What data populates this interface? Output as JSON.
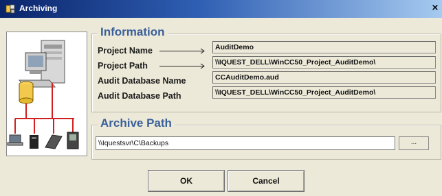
{
  "window": {
    "title": "Archiving",
    "close_glyph": "×"
  },
  "information": {
    "heading": "Information",
    "fields": [
      {
        "label": "Project Name",
        "value": "AuditDemo"
      },
      {
        "label": "Project Path",
        "value": "\\\\IQUEST_DELL\\WinCC50_Project_AuditDemo\\"
      },
      {
        "label": "Audit Database Name",
        "value": "CCAuditDemo.aud"
      },
      {
        "label": "Audit Database Path",
        "value": "\\\\IQUEST_DELL\\WinCC50_Project_AuditDemo\\"
      }
    ]
  },
  "archive": {
    "heading": "Archive Path",
    "path_value": "\\\\Iquestsvr\\C\\Backups",
    "browse_label": "..."
  },
  "buttons": {
    "ok": "OK",
    "cancel": "Cancel"
  },
  "icons": {
    "title_icon": "archiving-app-icon",
    "illustration": "network-devices-illustration"
  },
  "colors": {
    "title_gradient_start": "#0a246a",
    "title_gradient_end": "#a6caf0",
    "heading_color": "#3a5f9a",
    "window_bg": "#ece9d8"
  }
}
